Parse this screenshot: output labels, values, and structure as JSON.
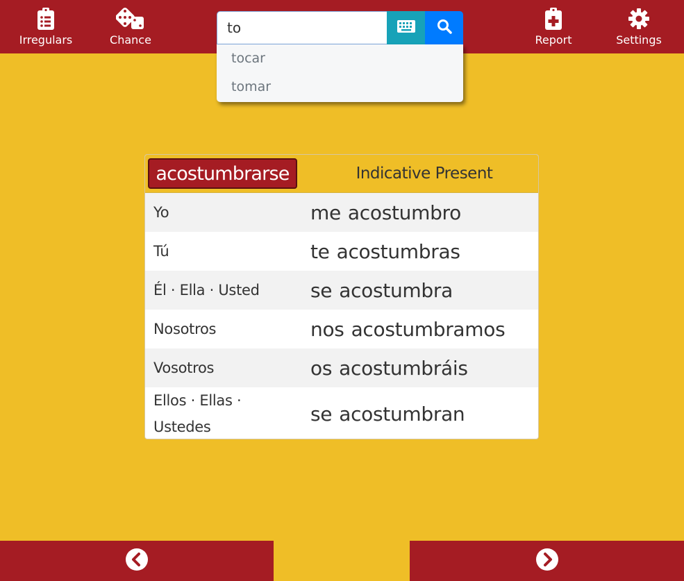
{
  "nav": {
    "irregulars_label": "Irregulars",
    "chance_label": "Chance",
    "report_label": "Report",
    "settings_label": "Settings"
  },
  "search": {
    "value": "to",
    "keyboard_icon": "keyboard-icon",
    "search_icon": "search-icon",
    "suggestions": [
      "tocar",
      "tomar"
    ]
  },
  "card": {
    "verb": "acostumbrarse",
    "tense": "Indicative Present",
    "rows": [
      {
        "pronoun": "Yo",
        "reflexive": "me",
        "form": "acostumbro"
      },
      {
        "pronoun": "Tú",
        "reflexive": "te",
        "form": "acostumbras"
      },
      {
        "pronoun": "Él · Ella · Usted",
        "reflexive": "se",
        "form": "acostumbra"
      },
      {
        "pronoun": "Nosotros",
        "reflexive": "nos",
        "form": "acostumbramos"
      },
      {
        "pronoun": "Vosotros",
        "reflexive": "os",
        "form": "acostumbráis"
      },
      {
        "pronoun": "Ellos · Ellas · Ustedes",
        "reflexive": "se",
        "form": "acostumbran"
      }
    ]
  },
  "colors": {
    "primary_red": "#a51c23",
    "background_yellow": "#efbe27",
    "keyboard_button": "#17a2b8",
    "search_button": "#007bff"
  }
}
